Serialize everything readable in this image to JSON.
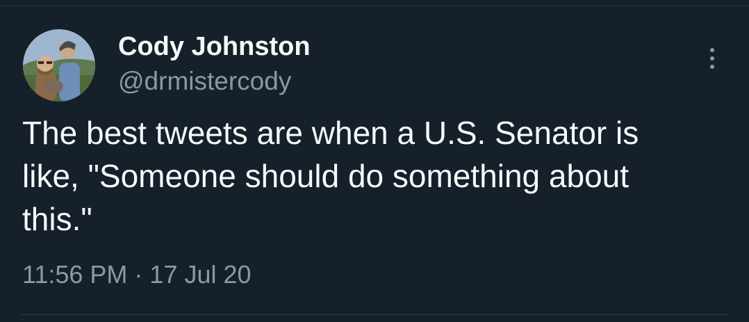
{
  "author": {
    "display_name": "Cody Johnston",
    "handle": "@drmistercody"
  },
  "tweet": {
    "lines": [
      "The best tweets are when a U.S. Senator is",
      "like, \"Someone should do something about",
      "this.\""
    ],
    "time": "11:56 PM",
    "separator": "·",
    "date": "17 Jul 20"
  },
  "icons": {
    "more": "more-vertical-icon"
  },
  "colors": {
    "background": "#15202b",
    "primary_text": "#f7f9f9",
    "secondary_text": "#8b98a5",
    "divider": "#2f3b47"
  }
}
